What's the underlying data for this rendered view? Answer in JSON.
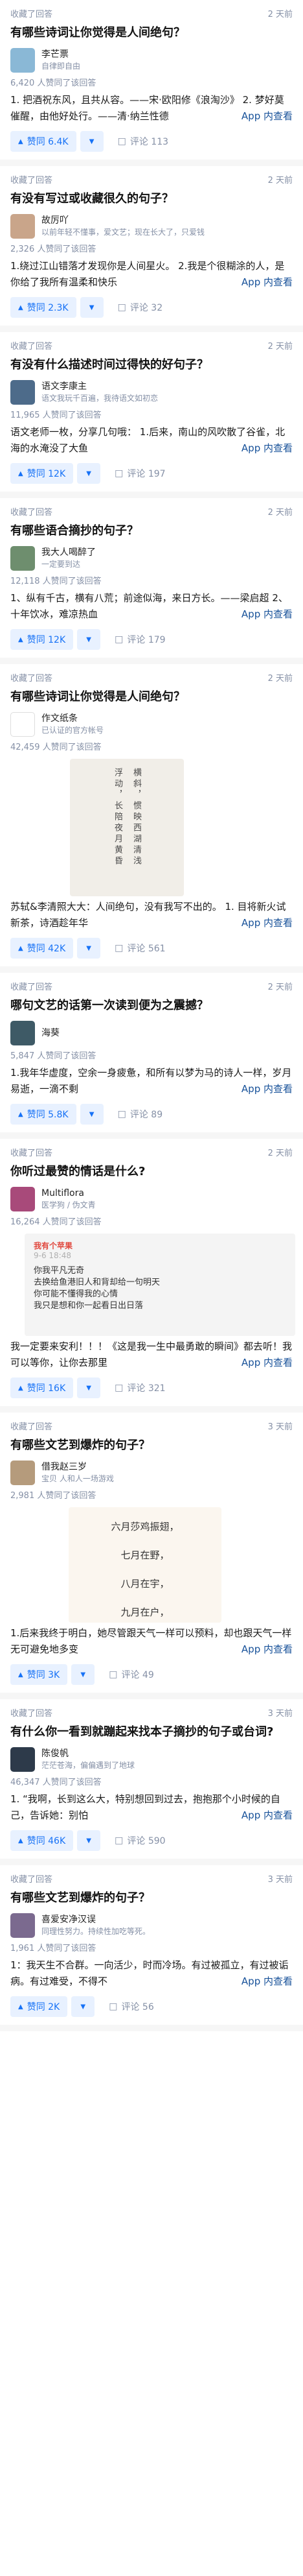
{
  "ui": {
    "read_more": "App 内查看",
    "vote_prefix": "赞同",
    "comment_prefix": "评论",
    "colors": {
      "accent": "#1772f6",
      "vote_bg": "#e8f1ff",
      "link": "#175199",
      "muted": "#8590a6"
    }
  },
  "feed": [
    {
      "source": "收藏了回答",
      "time": "2 天前",
      "title": "有哪些诗词让你觉得是人间绝句？",
      "author_name": "李芒票",
      "author_bio": "自律即自由",
      "stats": "6,420 人赞同了该回答",
      "excerpt": "1. 把酒祝东风，且共从容。——宋·欧阳修《浪淘沙》 2. 梦好莫催醒，由他好处行。——清·纳兰性德",
      "votes": "6.4K",
      "comments": "113",
      "avatar_color": "#8ab8d6"
    },
    {
      "source": "收藏了回答",
      "time": "2 天前",
      "title": "有没有写过或收藏很久的句子？",
      "author_name": "故厉吖",
      "author_bio": "以前年轻不懂事，爱文艺；现在长大了，只爱钱",
      "stats": "2,326 人赞同了该回答",
      "excerpt": "1.绕过江山错落才发现你是人间星火。 2.我是个很糊涂的人，是你给了我所有温柔和快乐",
      "votes": "2.3K",
      "comments": "32",
      "avatar_color": "#c9a58a"
    },
    {
      "source": "收藏了回答",
      "time": "2 天前",
      "title": "有没有什么描述时间过得快的好句子？",
      "author_name": "语文李康主",
      "author_bio": "语文我玩千百遍，我待语文如初恋",
      "stats": "11,965 人赞同了该回答",
      "excerpt": "语文老师一枚，分享几句哦： 1.后来，南山的风吹散了谷雀，北海的水淹没了大鱼",
      "votes": "12K",
      "comments": "197",
      "avatar_color": "#4d6b8a"
    },
    {
      "source": "收藏了回答",
      "time": "2 天前",
      "title": "有哪些语合摘抄的句子？",
      "author_name": "我大人喝醉了",
      "author_bio": "一定要到达",
      "stats": "12,118 人赞同了该回答",
      "excerpt": "1、纵有千古，横有八荒；前途似海，来日方长。——梁启超 2、十年饮冰，难凉热血",
      "votes": "12K",
      "comments": "179",
      "avatar_color": "#6e8e6e"
    },
    {
      "source": "收藏了回答",
      "time": "2 天前",
      "title": "有哪些诗词让你觉得是人间绝句？",
      "author_name": "作文纸条",
      "author_bio": "已认证的官方帐号",
      "stats": "42,459 人赞同了该回答",
      "poem_lines": [
        "浮动，长陪夜月黄昏",
        "横斜，惯映西湖清浅"
      ],
      "excerpt": "苏轼&李清照大大：人间绝句，没有我写不出的。 1. 目将新火试新茶，诗酒趁年华",
      "votes": "42K",
      "comments": "561",
      "avatar_color": "#ffffff"
    },
    {
      "source": "收藏了回答",
      "time": "2 天前",
      "title": "哪句文艺的话第一次读到便为之震撼？",
      "author_name": "海葵",
      "author_bio": "",
      "stats": "5,847 人赞同了该回答",
      "excerpt": "1.我年华虚度，空余一身疲惫，和所有以梦为马的诗人一样，岁月易逝，一滴不剩",
      "votes": "5.8K",
      "comments": "89",
      "avatar_color": "#3e5a66"
    },
    {
      "source": "收藏了回答",
      "time": "2 天前",
      "title": "你听过最赞的情话是什么?",
      "author_name": "Multiflora",
      "author_bio": "医学狗 / 伪文青",
      "stats": "16,264 人赞同了该回答",
      "note_head": "我有个苹果",
      "note_time": "9-6 18:48",
      "note_lines": [
        "你我平凡无奇",
        "去换给鱼港旧人和背却给一句明天",
        "你可能不懂得我的心情",
        "我只是想和你一起看日出日落"
      ],
      "excerpt": "我一定要来安利！！！《这是我一生中最勇敢的瞬间》都去听！我可以等你，让你去那里",
      "votes": "16K",
      "comments": "321",
      "avatar_color": "#a84a7a"
    },
    {
      "source": "收藏了回答",
      "time": "3 天前",
      "title": "有哪些文艺到爆炸的句子？",
      "author_name": "借我赵三岁",
      "author_bio": "宝贝 人和人一场游戏",
      "stats": "2,981 人赞同了该回答",
      "lines": [
        "六月莎鸡振翅，",
        "七月在野，",
        "八月在宇，",
        "九月在户，"
      ],
      "excerpt": "1.后来我终于明白，她尽管跟天气一样可以预料，却也跟天气一样无可避免地多变",
      "votes": "3K",
      "comments": "49",
      "avatar_color": "#b59b7c"
    },
    {
      "source": "收藏了回答",
      "time": "3 天前",
      "title": "有什么你一看到就蹦起来找本子摘抄的句子或台词?",
      "author_name": "陈俊帆",
      "author_bio": "茫茫苍海，偏偏遇到了地球",
      "stats": "46,347 人赞同了该回答",
      "excerpt": "1. “我啊，长到这么大，特别想回到过去，抱抱那个小时候的自己，告诉她：别怕",
      "votes": "46K",
      "comments": "590",
      "avatar_color": "#2d3a4a"
    },
    {
      "source": "收藏了回答",
      "time": "3 天前",
      "title": "有哪些文艺到爆炸的句子？",
      "author_name": "喜爱安净汉误",
      "author_bio": "同理性努力。持续性加吃等死。",
      "stats": "1,961 人赞同了该回答",
      "excerpt": "1：我天生不合群。一向活少，时而冷场。有过被孤立，有过被诟病。有过难受，不得不",
      "votes": "2K",
      "comments": "56",
      "avatar_color": "#7b6a8f"
    }
  ]
}
